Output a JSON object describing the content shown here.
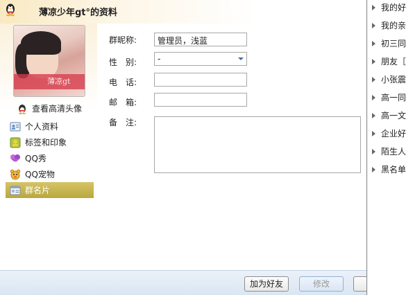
{
  "window": {
    "title": "薄凉少年gt°的资料",
    "avatar_caption": "薄凉gt"
  },
  "sidebar": {
    "hd_avatar_link": "查看高清头像",
    "items": [
      {
        "label": "个人资料",
        "icon": "profile-card-icon"
      },
      {
        "label": "标签和印象",
        "icon": "tag-portrait-icon"
      },
      {
        "label": "QQ秀",
        "icon": "qq-show-icon"
      },
      {
        "label": "QQ宠物",
        "icon": "qq-pet-icon"
      },
      {
        "label": "群名片",
        "icon": "group-card-icon",
        "active": true
      }
    ]
  },
  "form": {
    "nickname_label": "群昵称:",
    "nickname_value": "管理员，浅蓝",
    "gender_label": "性　别:",
    "gender_value": "-",
    "phone_label": "电　话:",
    "phone_value": "",
    "email_label": "邮　箱:",
    "email_value": "",
    "remark_label": "备　注:",
    "remark_value": ""
  },
  "buttons": {
    "add_friend": "加为好友",
    "modify": "修改"
  },
  "friend_groups": [
    "我的好",
    "我的亲",
    "初三同",
    "朋友［",
    "小张震",
    "高一同",
    "高一文",
    "企业好",
    "陌生人",
    "黑名单"
  ],
  "colors": {
    "active_nav": "#c2b04a",
    "bottom_bar": "#dbe6f3",
    "title_gradient": "#f9e9c2"
  }
}
